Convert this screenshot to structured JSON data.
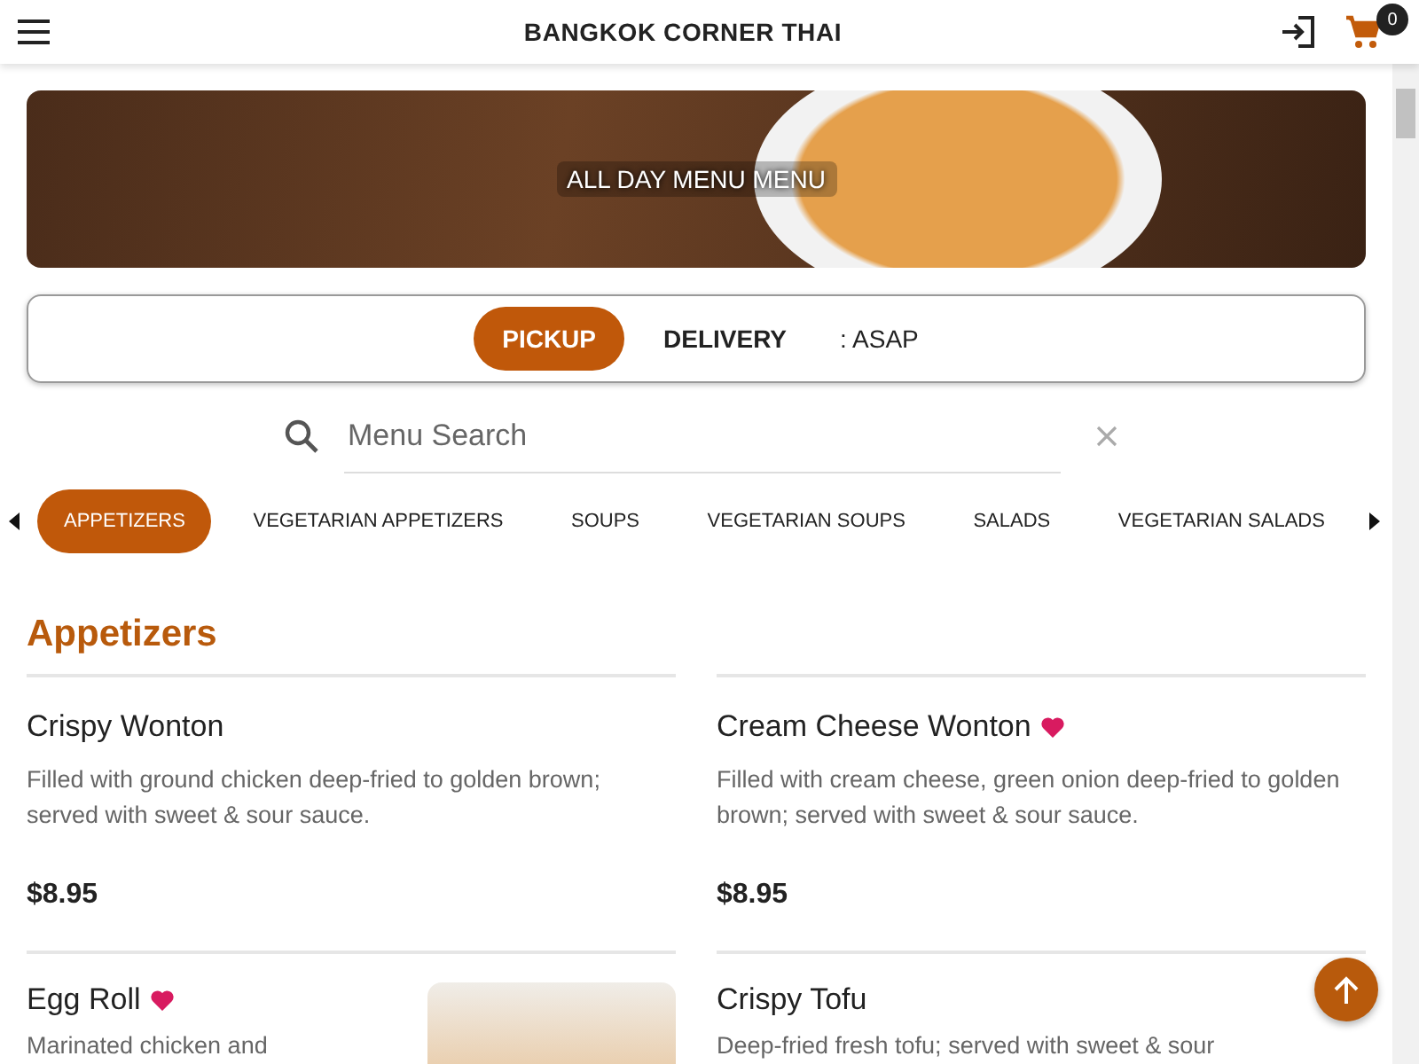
{
  "header": {
    "title": "BANGKOK CORNER THAI",
    "cart_count": "0"
  },
  "banner": {
    "title": "ALL DAY MENU MENU"
  },
  "order_mode": {
    "options": [
      {
        "label": "PICKUP",
        "selected": true
      },
      {
        "label": "DELIVERY",
        "selected": false
      }
    ],
    "time": ": ASAP"
  },
  "search": {
    "placeholder": "Menu Search"
  },
  "categories": [
    {
      "label": "APPETIZERS",
      "selected": true
    },
    {
      "label": "VEGETARIAN APPETIZERS",
      "selected": false
    },
    {
      "label": "SOUPS",
      "selected": false
    },
    {
      "label": "VEGETARIAN SOUPS",
      "selected": false
    },
    {
      "label": "SALADS",
      "selected": false
    },
    {
      "label": "VEGETARIAN SALADS",
      "selected": false
    }
  ],
  "section": {
    "title": "Appetizers",
    "items": [
      {
        "name": "Crispy Wonton",
        "favorite": false,
        "photo": false,
        "description": "Filled with ground chicken deep-fried to golden brown; served with sweet & sour sauce.",
        "price": "$8.95"
      },
      {
        "name": "Cream Cheese Wonton",
        "favorite": true,
        "photo": false,
        "description": "Filled with cream cheese, green onion deep-fried to golden brown; served with sweet & sour sauce.",
        "price": "$8.95"
      },
      {
        "name": "Egg Roll",
        "favorite": true,
        "photo": true,
        "description": "Marinated chicken and"
      },
      {
        "name": "Crispy Tofu",
        "favorite": false,
        "photo": false,
        "description": "Deep-fried fresh tofu; served with sweet & sour"
      }
    ]
  }
}
